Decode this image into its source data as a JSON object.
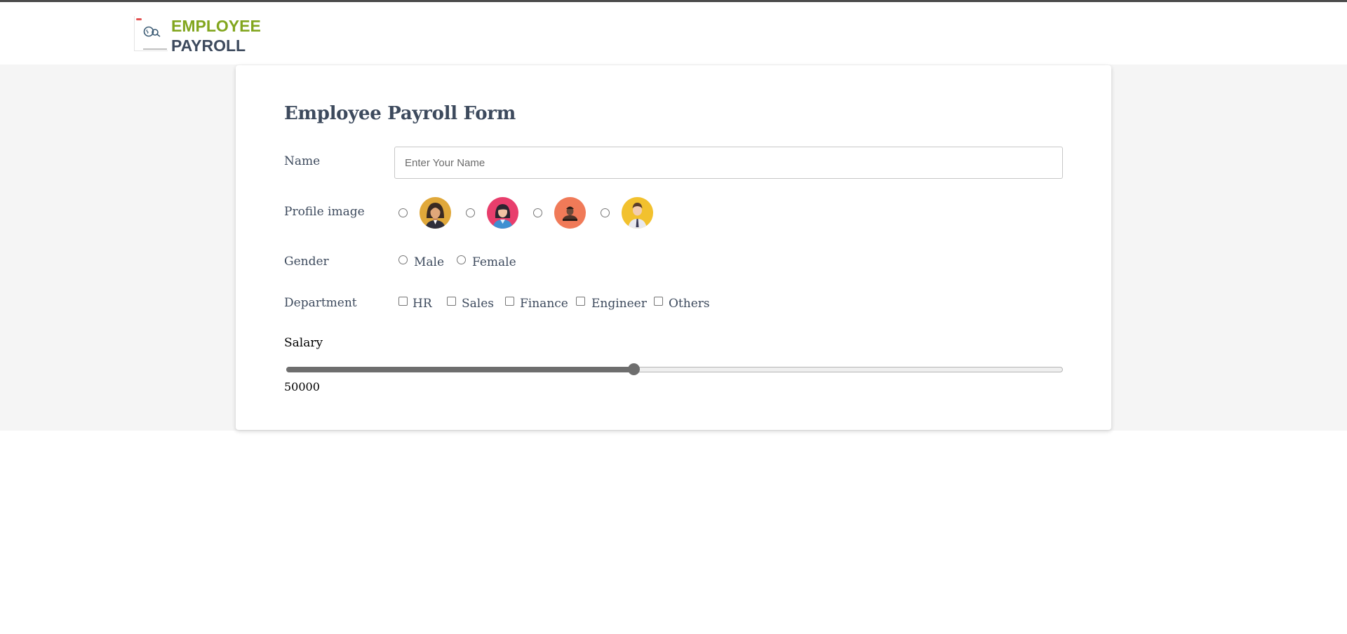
{
  "header": {
    "logo_line1": "EMPLOYEE",
    "logo_line2": "PAYROLL",
    "logo_line1_color": "#82a61e",
    "logo_line2_color": "#3d4a5d"
  },
  "form": {
    "title": "Employee Payroll Form",
    "name": {
      "label": "Name",
      "placeholder": "Enter Your Name",
      "value": ""
    },
    "profile_image": {
      "label": "Profile image",
      "options": [
        {
          "icon": "woman-avatar-icon",
          "bg": "#e0a83a"
        },
        {
          "icon": "woman-avatar-icon",
          "bg": "#e83e6c"
        },
        {
          "icon": "man-avatar-icon",
          "bg": "#f07a58"
        },
        {
          "icon": "man-avatar-icon",
          "bg": "#f2c12e"
        }
      ]
    },
    "gender": {
      "label": "Gender",
      "options": [
        "Male",
        "Female"
      ]
    },
    "department": {
      "label": "Department",
      "options": [
        "HR",
        "Sales",
        "Finance",
        "Engineer",
        "Others"
      ]
    },
    "salary": {
      "label": "Salary",
      "value": "50000",
      "fraction": 0.447
    }
  },
  "colors": {
    "text": "#3d4a5d",
    "band": "#f5f5f5",
    "slider": "#6e6e6e"
  }
}
